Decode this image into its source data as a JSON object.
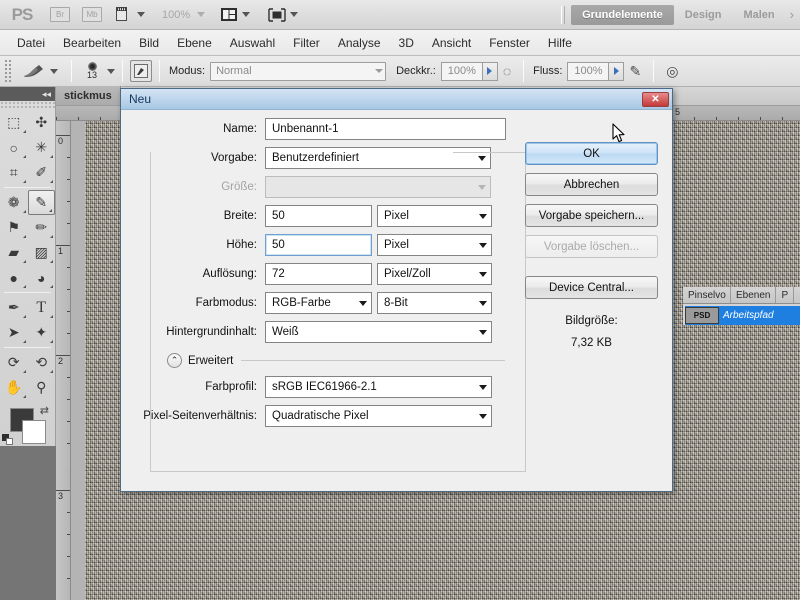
{
  "app": {
    "name": "PS",
    "zoom": "100%",
    "buttons": [
      {
        "name": "bridge",
        "label": "Br"
      },
      {
        "name": "mini-bridge",
        "label": "Mb"
      }
    ],
    "workspaces": [
      {
        "label": "Grundelemente",
        "active": true
      },
      {
        "label": "Design",
        "active": false
      },
      {
        "label": "Malen",
        "active": false
      }
    ],
    "workspace_more": "›"
  },
  "menu": {
    "items": [
      "Datei",
      "Bearbeiten",
      "Bild",
      "Ebene",
      "Auswahl",
      "Filter",
      "Analyse",
      "3D",
      "Ansicht",
      "Fenster",
      "Hilfe"
    ]
  },
  "options_bar": {
    "brush_size": "13",
    "mode_label": "Modus:",
    "mode_value": "Normal",
    "opacity_label": "Deckkr.:",
    "opacity_value": "100%",
    "flow_label": "Fluss:",
    "flow_value": "100%"
  },
  "toolbox": {
    "tools": [
      {
        "name": "rectangular-marquee-icon",
        "glyph": "⬚"
      },
      {
        "name": "move-icon",
        "glyph": "✣"
      },
      {
        "name": "lasso-icon",
        "glyph": "○"
      },
      {
        "name": "magic-wand-icon",
        "glyph": "✳"
      },
      {
        "name": "crop-icon",
        "glyph": "⌗"
      },
      {
        "name": "eyedropper-icon",
        "glyph": "✐"
      },
      {
        "name": "spot-healing-brush-icon",
        "glyph": "❁"
      },
      {
        "name": "brush-icon",
        "glyph": "✎"
      },
      {
        "name": "clone-stamp-icon",
        "glyph": "⚑"
      },
      {
        "name": "history-brush-icon",
        "glyph": "✏"
      },
      {
        "name": "eraser-icon",
        "glyph": "▰"
      },
      {
        "name": "gradient-icon",
        "glyph": "▨"
      },
      {
        "name": "blur-icon",
        "glyph": "●"
      },
      {
        "name": "dodge-icon",
        "glyph": "◕"
      },
      {
        "name": "pen-icon",
        "glyph": "✒"
      },
      {
        "name": "type-icon",
        "glyph": "T"
      },
      {
        "name": "path-selection-icon",
        "glyph": "➤"
      },
      {
        "name": "custom-shape-icon",
        "glyph": "✦"
      },
      {
        "name": "3d-rotate-icon",
        "glyph": "⟳"
      },
      {
        "name": "3d-orbit-icon",
        "glyph": "⟲"
      },
      {
        "name": "hand-icon",
        "glyph": "✋"
      },
      {
        "name": "zoom-icon",
        "glyph": "⚲"
      }
    ],
    "selected_tool_index": 7,
    "foreground_color": "#3a3a3a",
    "background_color": "#ffffff"
  },
  "document": {
    "tab_label": "stickmus",
    "hruler_labels": [
      "5"
    ],
    "vruler_labels": [
      "0",
      "1",
      "2",
      "3"
    ]
  },
  "right_panel": {
    "tabs": [
      "Pinselvo",
      "Ebenen",
      "P"
    ],
    "path_item": {
      "thumb_text": "PSD",
      "name": "Arbeitspfad"
    }
  },
  "dialog": {
    "title": "Neu",
    "close_label": "✕",
    "fields": [
      {
        "label": "Name:",
        "value": "Unbenannt-1",
        "type": "text",
        "disabled": false,
        "focused": false
      },
      {
        "label": "Vorgabe:",
        "value": "Benutzerdefiniert",
        "type": "combo",
        "disabled": false
      },
      {
        "label": "Größe:",
        "value": "",
        "type": "combo",
        "disabled": true
      }
    ],
    "dimension_rows": [
      {
        "label": "Breite:",
        "value": "50",
        "unit": "Pixel",
        "focused": false
      },
      {
        "label": "Höhe:",
        "value": "50",
        "unit": "Pixel",
        "focused": true
      },
      {
        "label": "Auflösung:",
        "value": "72",
        "unit": "Pixel/Zoll",
        "focused": false
      }
    ],
    "color_mode": {
      "label": "Farbmodus:",
      "value": "RGB-Farbe",
      "depth": "8-Bit"
    },
    "background": {
      "label": "Hintergrundinhalt:",
      "value": "Weiß"
    },
    "advanced": {
      "label": "Erweitert",
      "chevron": "⌃"
    },
    "advanced_fields": [
      {
        "label": "Farbprofil:",
        "value": "sRGB IEC61966-2.1"
      },
      {
        "label": "Pixel-Seitenverhältnis:",
        "value": "Quadratische Pixel"
      }
    ],
    "buttons": [
      {
        "name": "ok-button",
        "label": "OK",
        "style": "primary",
        "disabled": false
      },
      {
        "name": "cancel-button",
        "label": "Abbrechen",
        "style": "normal",
        "disabled": false
      },
      {
        "name": "save-preset-button",
        "label": "Vorgabe speichern...",
        "style": "normal",
        "disabled": false
      },
      {
        "name": "delete-preset-button",
        "label": "Vorgabe löschen...",
        "style": "normal",
        "disabled": true
      },
      {
        "name": "device-central-button",
        "label": "Device Central...",
        "style": "normal",
        "disabled": false
      }
    ],
    "image_size": {
      "label": "Bildgröße:",
      "value": "7,32 KB"
    }
  },
  "colors": {
    "dialog_title_bg": "#a9c8e4",
    "accent_blue": "#1f7fe0",
    "close_red": "#c33a3a",
    "app_bg": "#d2d2d2"
  }
}
